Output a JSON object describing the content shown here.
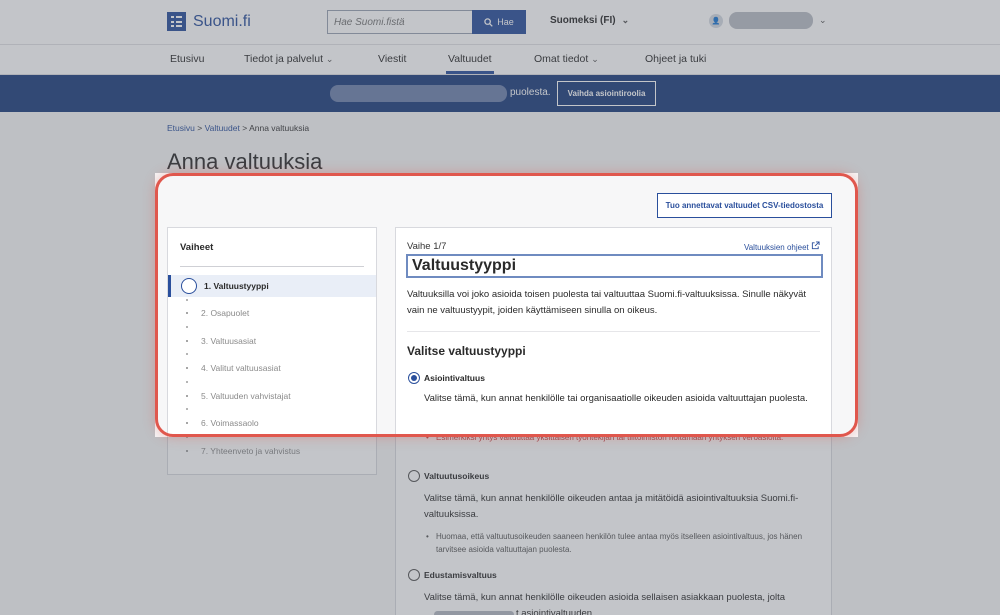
{
  "header": {
    "logo_text": "Suomi.fi",
    "search_placeholder": "Hae Suomi.fistä",
    "search_button": "Hae",
    "language": "Suomeksi (FI)"
  },
  "nav": {
    "items": [
      "Etusivu",
      "Tiedot ja palvelut",
      "Viestit",
      "Valtuudet",
      "Omat tiedot",
      "Ohjeet ja tuki"
    ]
  },
  "role_bar": {
    "suffix_text": "puolesta.",
    "switch_button": "Vaihda asiointiroolia"
  },
  "breadcrumb": {
    "items": [
      "Etusivu",
      "Valtuudet",
      "Anna valtuuksia"
    ]
  },
  "page_title": "Anna valtuuksia",
  "csv_button": "Tuo annettavat valtuudet CSV-tiedostosta",
  "steps": {
    "title": "Vaiheet",
    "items": [
      "1. Valtuustyyppi",
      "2. Osapuolet",
      "3. Valtuusasiat",
      "4. Valitut valtuusasiat",
      "5. Valtuuden vahvistajat",
      "6. Voimassaolo",
      "7. Yhteenveto ja vahvistus"
    ]
  },
  "main": {
    "phase": "Vaihe 1/7",
    "help_link": "Valtuuksien ohjeet",
    "title": "Valtuustyyppi",
    "intro": "Valtuuksilla voi joko asioida toisen puolesta tai valtuuttaa Suomi.fi-valtuuksissa. Sinulle näkyvät vain ne valtuustyypit, joiden käyttämiseen sinulla on oikeus.",
    "choose_heading": "Valitse valtuustyyppi",
    "options": [
      {
        "label": "Asiointivaltuus",
        "description": "Valitse tämä, kun annat henkilölle tai organisaatiolle oikeuden asioida valtuuttajan puolesta.",
        "note": "Esimerkiksi yritys valtuuttaa yksittäisen työntekijän tai tilitoimiston hoitamaan yrityksen veroasioita."
      },
      {
        "label": "Valtuutusoikeus",
        "description": "Valitse tämä, kun annat henkilölle oikeuden antaa ja mitätöidä asiointivaltuuksia Suomi.fi-valtuuksissa.",
        "note": "Huomaa, että valtuutusoikeuden saaneen henkilön tulee antaa myös itselleen asiointivaltuus, jos hänen tarvitsee asioida valtuuttajan puolesta."
      },
      {
        "label": "Edustamisvaltuus",
        "description": "Valitse tämä, kun annat henkilölle oikeuden asioida sellaisen asiakkaan puolesta, jolta",
        "description_cont": "t asiointivaltuuden."
      }
    ]
  }
}
